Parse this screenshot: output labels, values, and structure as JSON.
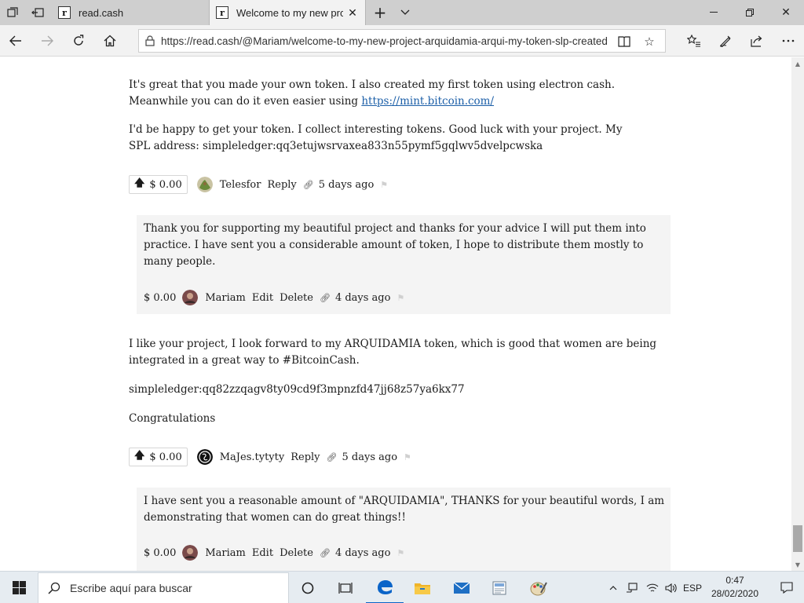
{
  "browser": {
    "tabs": [
      {
        "title": "read.cash",
        "favicon": "r"
      },
      {
        "title": "Welcome to my new pro",
        "favicon": "r"
      }
    ],
    "url": "https://read.cash/@Mariam/welcome-to-my-new-project-arquidamia-arqui-my-token-slp-created"
  },
  "comments": [
    {
      "para1_text": "It's great that you made your own token. I also created my first token using electron cash. Meanwhile you can do it even easier using ",
      "para1_link": "https://mint.bitcoin.com/",
      "para2": "I'd be happy to get your token. I collect interesting tokens. Good luck with your project. My SPL address: simpleledger:qq3etujwsrvaxea833n55pymf5gqlwv5dvelpcwska",
      "amount": "$ 0.00",
      "author": "Telesfor",
      "reply_label": "Reply",
      "time": "5 days ago"
    },
    {
      "text": "Thank you for supporting my beautiful project and thanks for your advice I will put them into practice. I have sent you a considerable amount of token, I hope to distribute them mostly to many people.",
      "amount": "$ 0.00",
      "author": "Mariam",
      "edit_label": "Edit",
      "delete_label": "Delete",
      "time": "4 days ago"
    },
    {
      "para1": "I like your project, I look forward to my ARQUIDAMIA token, which is good that women are being integrated in a great way to #BitcoinCash.",
      "para2": "simpleledger:qq82zzqagv8ty09cd9f3mpnzfd47jj68z57ya6kx77",
      "para3": "Congratulations",
      "amount": "$ 0.00",
      "author": "MaJes.tytyty",
      "reply_label": "Reply",
      "time": "5 days ago"
    },
    {
      "text": "I have sent you a reasonable amount of \"ARQUIDAMIA\", THANKS for your beautiful words, I am demonstrating that women can do great things!!",
      "amount": "$ 0.00",
      "author": "Mariam",
      "edit_label": "Edit",
      "delete_label": "Delete",
      "time": "4 days ago"
    }
  ],
  "taskbar": {
    "search_placeholder": "Escribe aquí para buscar",
    "language": "ESP",
    "time": "0:47",
    "date": "28/02/2020"
  },
  "colors": {
    "link": "#1c5fa8",
    "reply_bg": "#f4f4f4",
    "edge_blue": "#0a64c8"
  }
}
